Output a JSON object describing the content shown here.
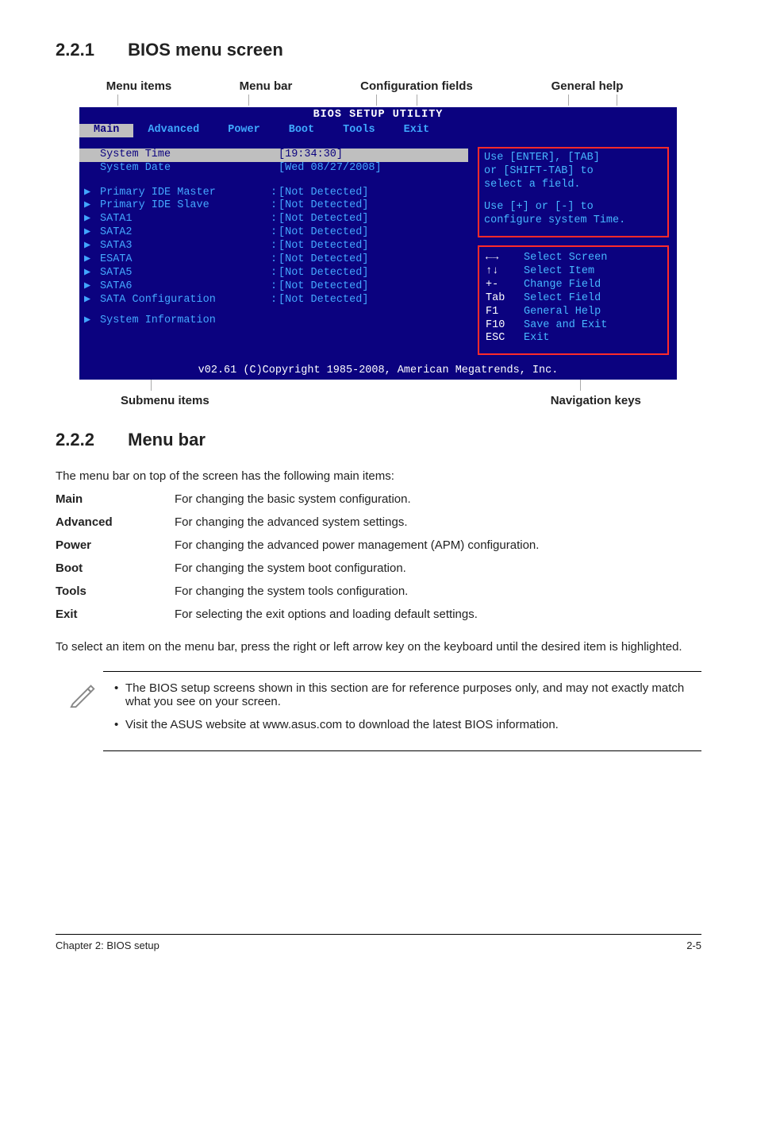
{
  "sections": {
    "s1": {
      "num": "2.2.1",
      "title": "BIOS menu screen"
    },
    "s2": {
      "num": "2.2.2",
      "title": "Menu bar"
    }
  },
  "diagram_labels": {
    "menu_items": "Menu items",
    "menu_bar": "Menu bar",
    "config_fields": "Configuration fields",
    "general_help": "General help",
    "submenu_items": "Submenu items",
    "nav_keys": "Navigation keys"
  },
  "bios": {
    "title": "BIOS SETUP UTILITY",
    "menubar": [
      "Main",
      "Advanced",
      "Power",
      "Boot",
      "Tools",
      "Exit"
    ],
    "selected_tab": 0,
    "sys_time_label": "System Time",
    "sys_time_val": "[19:34:30]",
    "sys_date_label": "System Date",
    "sys_date_val": "[Wed 08/27/2008]",
    "items": [
      {
        "label": "Primary IDE Master",
        "val": "[Not Detected]"
      },
      {
        "label": "Primary IDE Slave",
        "val": "[Not Detected]"
      },
      {
        "label": "SATA1",
        "val": "[Not Detected]"
      },
      {
        "label": "SATA2",
        "val": "[Not Detected]"
      },
      {
        "label": "SATA3",
        "val": "[Not Detected]"
      },
      {
        "label": "ESATA",
        "val": "[Not Detected]"
      },
      {
        "label": "SATA5",
        "val": "[Not Detected]"
      },
      {
        "label": "SATA6",
        "val": "[Not Detected]"
      },
      {
        "label": "SATA Configuration",
        "val": "[Not Detected]"
      }
    ],
    "sysinfo": "System Information",
    "help": {
      "l1": "Use [ENTER], [TAB]",
      "l2": "or [SHIFT-TAB] to",
      "l3": "select a field.",
      "l4": "Use [+] or [-] to",
      "l5": "configure system Time."
    },
    "nav": [
      {
        "key": "←→",
        "desc": "Select Screen"
      },
      {
        "key": "↑↓",
        "desc": "Select Item"
      },
      {
        "key": "+-",
        "desc": "Change Field"
      },
      {
        "key": "Tab",
        "desc": "Select Field"
      },
      {
        "key": "F1",
        "desc": "General Help"
      },
      {
        "key": "F10",
        "desc": "Save and Exit"
      },
      {
        "key": "ESC",
        "desc": "Exit"
      }
    ],
    "footer": "v02.61 (C)Copyright 1985-2008, American Megatrends, Inc."
  },
  "menubar_intro": "The menu bar on top of the screen has the following main items:",
  "menubar_items": [
    {
      "name": "Main",
      "desc": "For changing the basic system configuration."
    },
    {
      "name": "Advanced",
      "desc": "For changing the advanced system settings."
    },
    {
      "name": "Power",
      "desc": "For changing the advanced power management (APM) configuration."
    },
    {
      "name": "Boot",
      "desc": "For changing the system boot configuration."
    },
    {
      "name": "Tools",
      "desc": "For changing the system tools configuration."
    },
    {
      "name": "Exit",
      "desc": "For selecting the exit options and loading default settings."
    }
  ],
  "select_hint": "To select an item on the menu bar, press the right or left arrow key on the keyboard until the desired item is highlighted.",
  "notes": {
    "n1": "The BIOS setup screens shown in this section are for reference purposes only, and may not exactly match what you see on your screen.",
    "n2": "Visit the ASUS website at www.asus.com to download the latest BIOS information."
  },
  "footer": {
    "chapter": "Chapter 2: BIOS setup",
    "page": "2-5"
  }
}
